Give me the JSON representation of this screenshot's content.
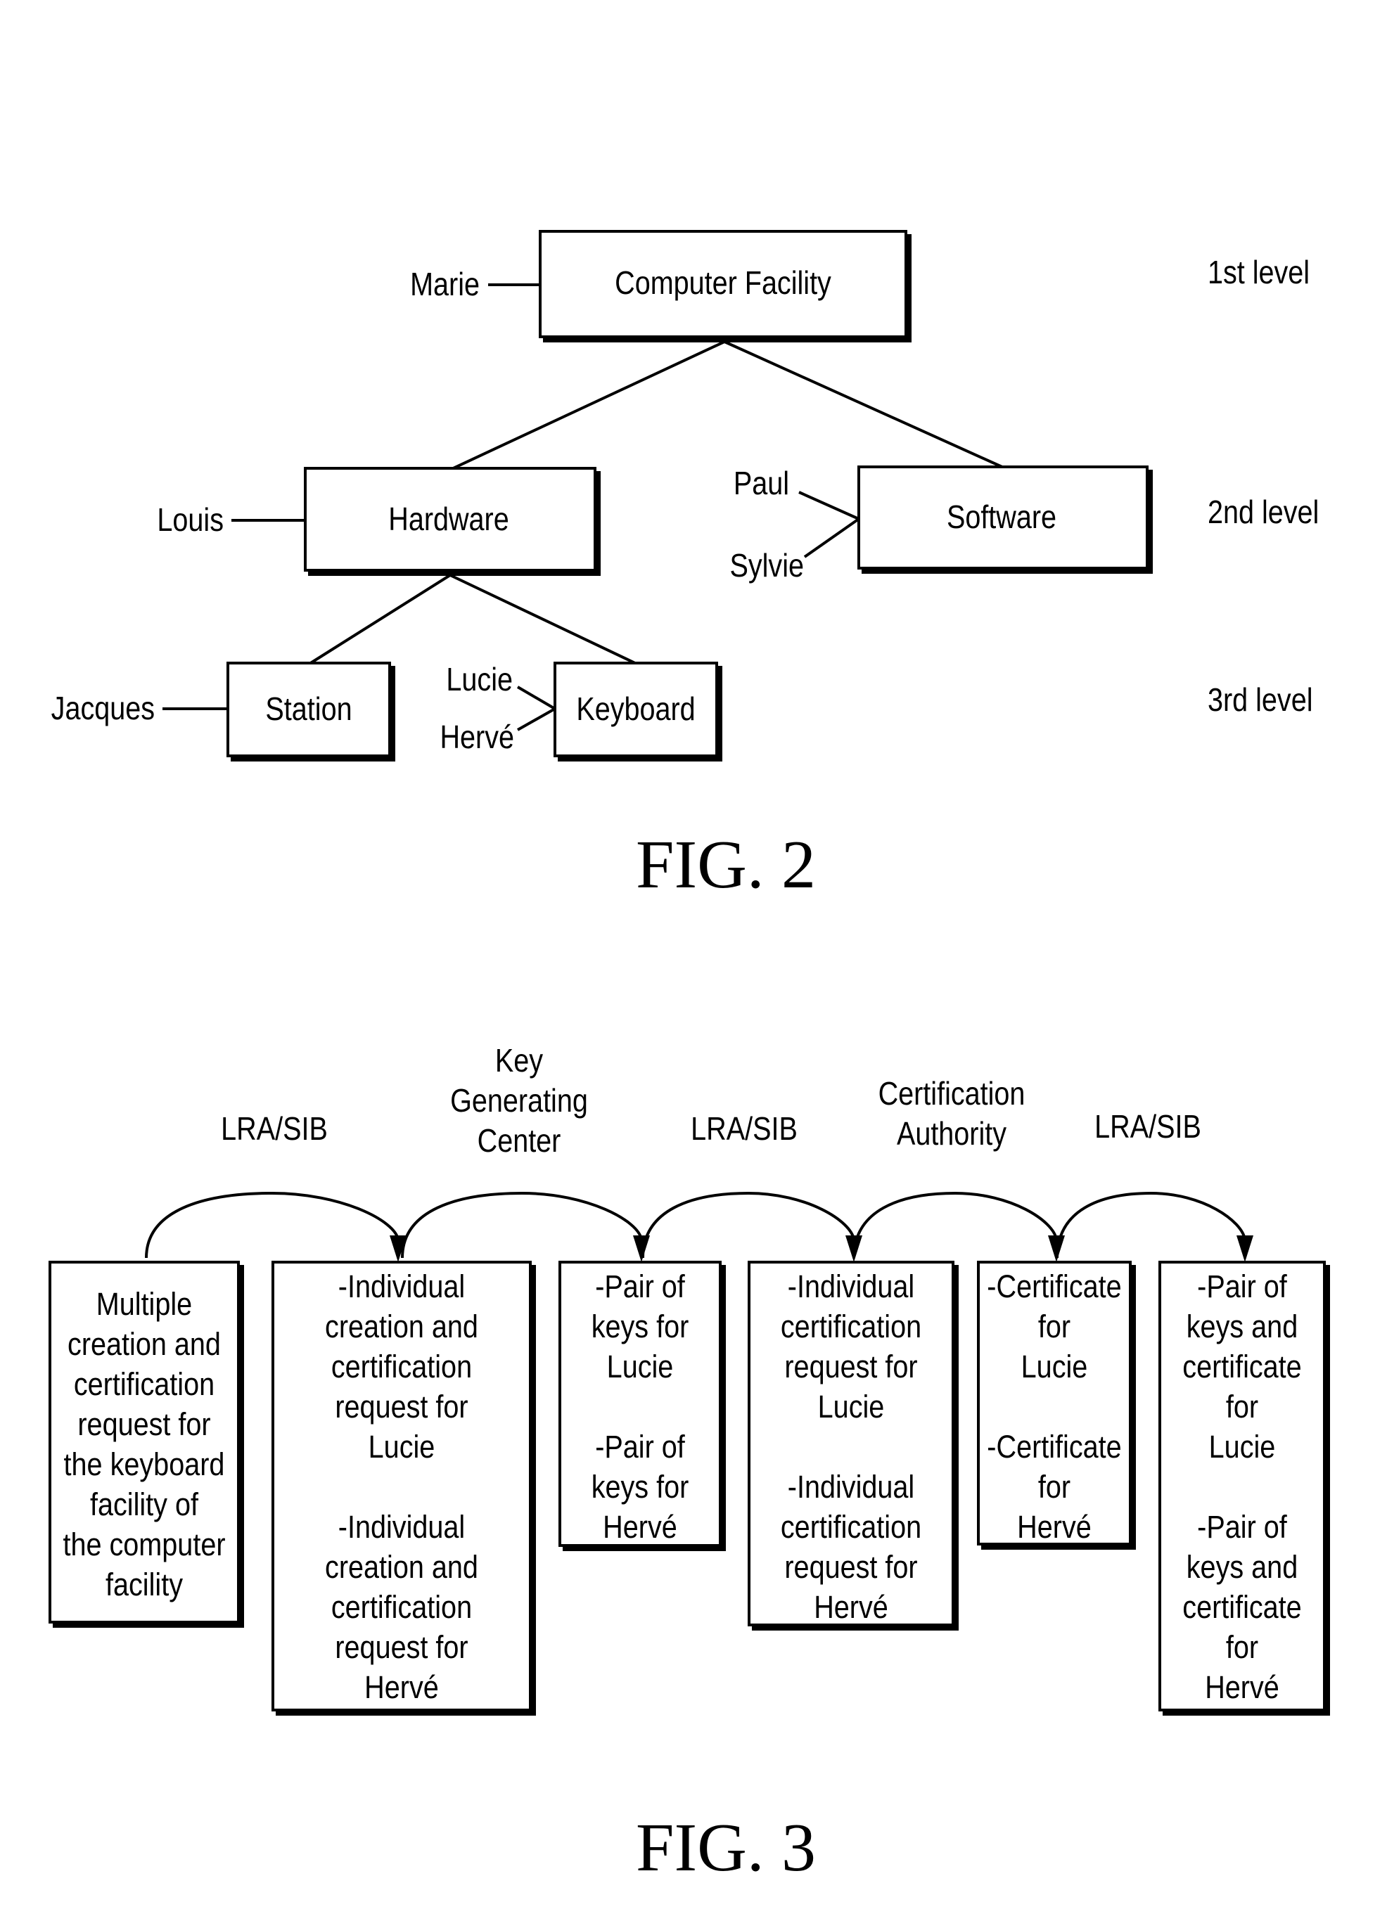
{
  "fig2": {
    "caption": "FIG. 2",
    "levels": [
      "1st level",
      "2nd level",
      "3rd level"
    ],
    "nodes": {
      "computer_facility": {
        "label": "Computer Facility",
        "people": [
          "Marie"
        ]
      },
      "hardware": {
        "label": "Hardware",
        "people": [
          "Louis"
        ]
      },
      "software": {
        "label": "Software",
        "people": [
          "Paul",
          "Sylvie"
        ]
      },
      "station": {
        "label": "Station",
        "people": [
          "Jacques"
        ]
      },
      "keyboard": {
        "label": "Keyboard",
        "people": [
          "Lucie",
          "Hervé"
        ]
      }
    },
    "edges": [
      [
        "computer_facility",
        "hardware"
      ],
      [
        "computer_facility",
        "software"
      ],
      [
        "hardware",
        "station"
      ],
      [
        "hardware",
        "keyboard"
      ]
    ]
  },
  "fig3": {
    "caption": "FIG. 3",
    "transitions": [
      {
        "label": [
          "LRA/SIB"
        ]
      },
      {
        "label": [
          "Key",
          "Generating",
          "Center"
        ]
      },
      {
        "label": [
          "LRA/SIB"
        ]
      },
      {
        "label": [
          "Certification",
          "Authority"
        ]
      },
      {
        "label": [
          "LRA/SIB"
        ]
      }
    ],
    "boxes": [
      {
        "lines": [
          "Multiple",
          "creation and",
          "certification",
          "request for",
          "the keyboard",
          "facility of",
          "the computer",
          "facility"
        ]
      },
      {
        "lines": [
          "-Individual",
          "creation and",
          "certification",
          "request for",
          "Lucie",
          "",
          "-Individual",
          "creation and",
          "certification",
          "request for",
          "Hervé"
        ]
      },
      {
        "lines": [
          "-Pair of",
          "keys for",
          "Lucie",
          "",
          "-Pair of",
          "keys for",
          "Hervé"
        ]
      },
      {
        "lines": [
          "-Individual",
          "certification",
          "request for",
          "Lucie",
          "",
          "-Individual",
          "certification",
          "request for",
          "Hervé"
        ]
      },
      {
        "lines": [
          "-Certificate",
          "for",
          "Lucie",
          "",
          "-Certificate",
          "for",
          "Hervé"
        ]
      },
      {
        "lines": [
          "-Pair of",
          "keys and",
          "certificate",
          "for",
          "Lucie",
          "",
          "-Pair of",
          "keys and",
          "certificate",
          "for",
          "Hervé"
        ]
      }
    ]
  }
}
